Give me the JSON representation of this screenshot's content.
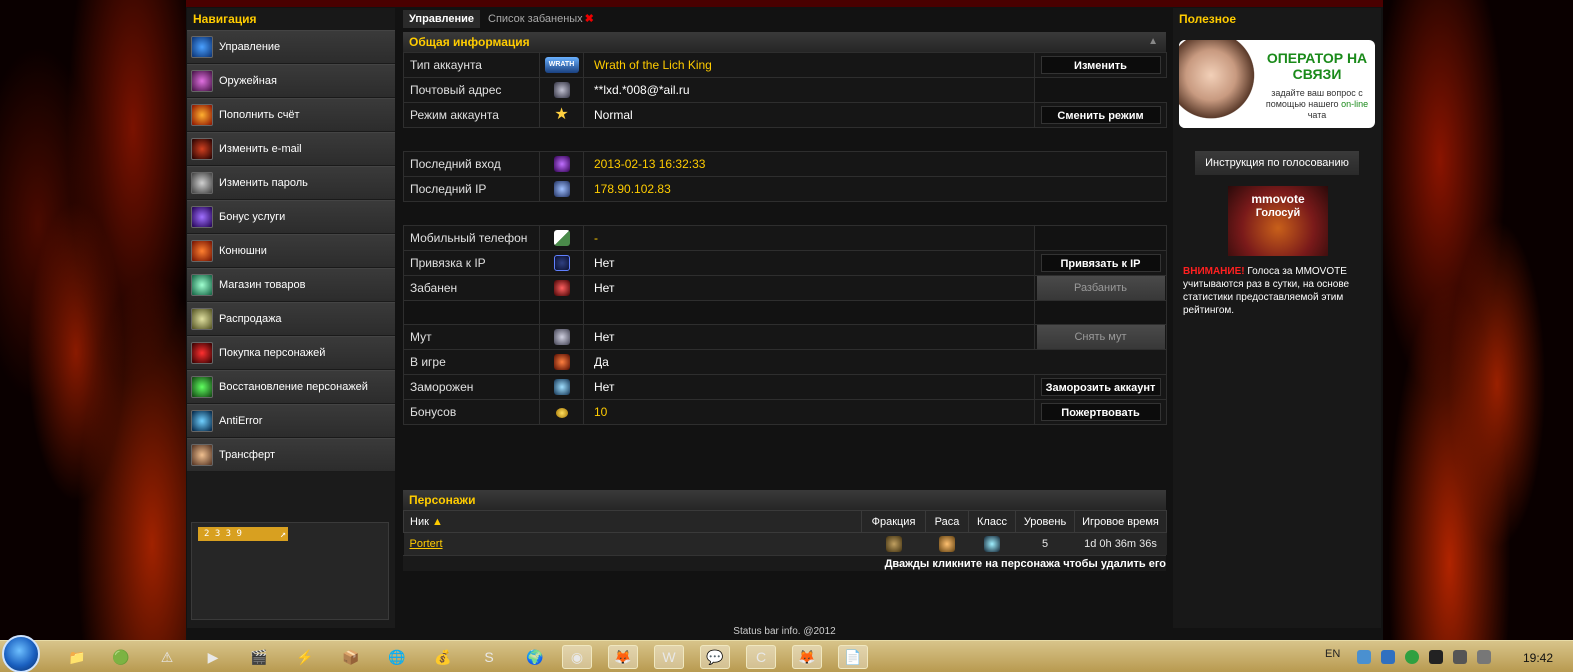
{
  "nav": {
    "title": "Навигация",
    "items": [
      {
        "label": "Управление",
        "icon": "arrows-icon"
      },
      {
        "label": "Оружейная",
        "icon": "swords-icon"
      },
      {
        "label": "Пополнить счёт",
        "icon": "fire-icon"
      },
      {
        "label": "Изменить e-mail",
        "icon": "dragon-icon"
      },
      {
        "label": "Изменить пароль",
        "icon": "face-icon"
      },
      {
        "label": "Бонус услуги",
        "icon": "sword-icon"
      },
      {
        "label": "Конюшни",
        "icon": "horse-icon"
      },
      {
        "label": "Магазин товаров",
        "icon": "orb-icon"
      },
      {
        "label": "Распродажа",
        "icon": "bag-icon"
      },
      {
        "label": "Покупка персонажей",
        "icon": "demon-icon"
      },
      {
        "label": "Восстановление персонажей",
        "icon": "nature-icon"
      },
      {
        "label": "AntiError",
        "icon": "swirl-icon"
      },
      {
        "label": "Трансферт",
        "icon": "portrait-icon"
      }
    ],
    "counter": "2 3 3 9"
  },
  "tabs": [
    {
      "label": "Управление",
      "active": true
    },
    {
      "label": "Список забаненых",
      "active": false
    }
  ],
  "info": {
    "title": "Общая информация",
    "account_type": {
      "label": "Тип аккаунта",
      "value": "Wrath of the Lich King",
      "icon_text": "WRATH",
      "button": "Изменить"
    },
    "email": {
      "label": "Почтовый адрес",
      "value": "**lxd.*008@*ail.ru"
    },
    "mode": {
      "label": "Режим аккаунта",
      "value": "Normal",
      "button": "Сменить режим"
    },
    "last_login": {
      "label": "Последний вход",
      "value": "2013-02-13 16:32:33"
    },
    "last_ip": {
      "label": "Последний IP",
      "value": "178.90.102.83"
    },
    "phone": {
      "label": "Мобильный телефон",
      "value": "-"
    },
    "ip_bind": {
      "label": "Привязка к IP",
      "value": "Нет",
      "button": "Привязать к IP"
    },
    "banned": {
      "label": "Забанен",
      "value": "Нет",
      "button": "Разбанить"
    },
    "mute": {
      "label": "Мут",
      "value": "Нет",
      "button": "Снять мут"
    },
    "in_game": {
      "label": "В игре",
      "value": "Да"
    },
    "frozen": {
      "label": "Заморожен",
      "value": "Нет",
      "button": "Заморозить аккаунт"
    },
    "bonuses": {
      "label": "Бонусов",
      "value": "10",
      "button": "Пожертвовать"
    }
  },
  "characters": {
    "title": "Персонажи",
    "columns": {
      "nick": "Ник",
      "faction": "Фракция",
      "race": "Раса",
      "class": "Класс",
      "level": "Уровень",
      "playtime": "Игровое время"
    },
    "rows": [
      {
        "nick": "Portert",
        "level": "5",
        "playtime": "1d 0h 36m 36s"
      }
    ],
    "hint": "Дважды кликните на персонажа чтобы удалить его"
  },
  "right": {
    "title": "Полезное",
    "operator_title": "ОПЕРАТОР НА СВЯЗИ",
    "operator_sub": "задайте ваш вопрос с помощью нашего",
    "operator_online": "on-line",
    "operator_chat": "чата",
    "vote_button": "Инструкция по голосованию",
    "mmovote_title": "mmovote",
    "mmovote_sub": "Голосуй",
    "warning_label": "ВНИМАНИЕ!",
    "warning_text": "Голоса за MMOVOTE учитываются раз в сутки, на основе статистики предоставляемой этим рейтингом."
  },
  "status_bar": "Status bar info. @2012",
  "taskbar": {
    "lang": "EN",
    "time": "19:42"
  },
  "colors": {
    "accent": "#ffcc00",
    "danger": "#ff2020",
    "panel": "#1b1b1b"
  }
}
